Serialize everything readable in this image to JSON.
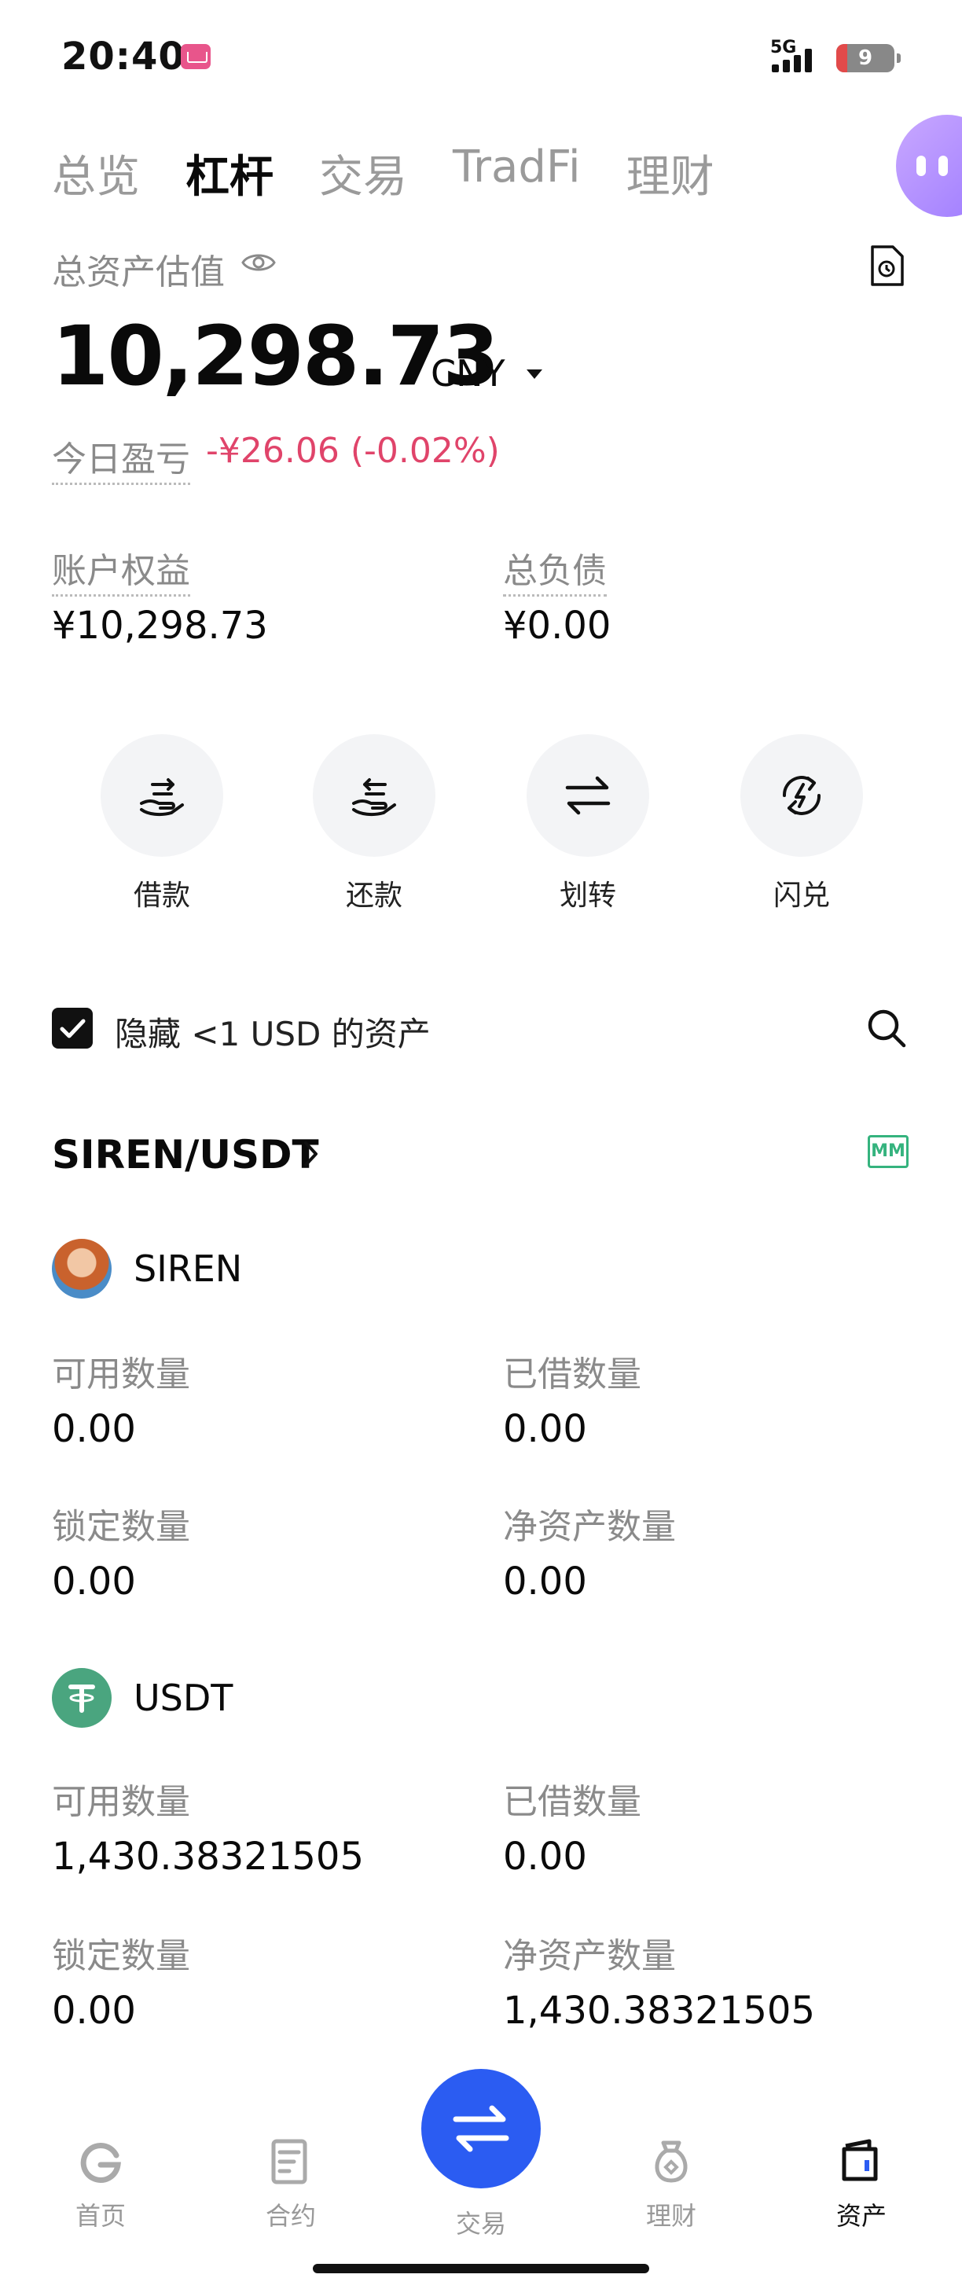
{
  "status_bar": {
    "time": "20:40",
    "network": "5G",
    "battery": "9"
  },
  "tabs": [
    {
      "label": "总览",
      "active": false
    },
    {
      "label": "杠杆",
      "active": true
    },
    {
      "label": "交易",
      "active": false
    },
    {
      "label": "TradFi",
      "active": false
    },
    {
      "label": "理财",
      "active": false
    }
  ],
  "summary": {
    "total_label": "总资产估值",
    "total_value": "10,298.73",
    "currency": "CNY",
    "pnl_label": "今日盈亏",
    "pnl_value": "-¥26.06 (-0.02%)",
    "equity_label": "账户权益",
    "equity_value": "¥10,298.73",
    "debt_label": "总负债",
    "debt_value": "¥0.00"
  },
  "actions": [
    {
      "label": "借款",
      "icon": "borrow-hand-icon"
    },
    {
      "label": "还款",
      "icon": "repay-hand-icon"
    },
    {
      "label": "划转",
      "icon": "transfer-arrows-icon"
    },
    {
      "label": "闪兑",
      "icon": "flash-convert-icon"
    }
  ],
  "filter": {
    "hide_small": "隐藏 <1 USD 的资产",
    "checked": true
  },
  "pair": {
    "name": "SIREN/USDT",
    "badge": "MM"
  },
  "assets": [
    {
      "coin": "SIREN",
      "available_label": "可用数量",
      "available": "0.00",
      "borrowed_label": "已借数量",
      "borrowed": "0.00",
      "locked_label": "锁定数量",
      "locked": "0.00",
      "net_label": "净资产数量",
      "net": "0.00"
    },
    {
      "coin": "USDT",
      "available_label": "可用数量",
      "available": "1,430.38321505",
      "borrowed_label": "已借数量",
      "borrowed": "0.00",
      "locked_label": "锁定数量",
      "locked": "0.00",
      "net_label": "净资产数量",
      "net": "1,430.38321505"
    }
  ],
  "nav": [
    {
      "label": "首页",
      "icon": "home-icon",
      "active": false
    },
    {
      "label": "合约",
      "icon": "contract-icon",
      "active": false
    },
    {
      "label": "交易",
      "icon": "trade-swap-icon",
      "active": false
    },
    {
      "label": "理财",
      "icon": "finance-bag-icon",
      "active": false
    },
    {
      "label": "资产",
      "icon": "wallet-icon",
      "active": true
    }
  ],
  "colors": {
    "accent": "#2b5cf2",
    "loss": "#e0446a",
    "mm_badge": "#35b37e",
    "usdt": "#4aa57f"
  }
}
